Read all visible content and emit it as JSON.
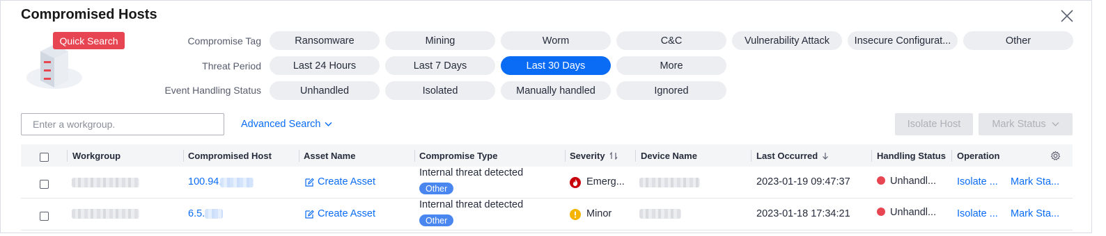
{
  "dialog": {
    "title": "Compromised Hosts",
    "quick_search": "Quick Search"
  },
  "filters": {
    "compromise_tag": {
      "label": "Compromise Tag",
      "options": [
        "Ransomware",
        "Mining",
        "Worm",
        "C&C",
        "Vulnerability Attack",
        "Insecure Configurat...",
        "Other"
      ]
    },
    "threat_period": {
      "label": "Threat Period",
      "options": [
        "Last 24 Hours",
        "Last 7 Days",
        "Last 30 Days",
        "More"
      ],
      "selected": "Last 30 Days"
    },
    "event_handling_status": {
      "label": "Event Handling Status",
      "options": [
        "Unhandled",
        "Isolated",
        "Manually handled",
        "Ignored"
      ]
    }
  },
  "toolbar": {
    "search_placeholder": "Enter a workgroup.",
    "advanced_search": "Advanced Search",
    "isolate_host": "Isolate Host",
    "mark_status": "Mark Status"
  },
  "table": {
    "columns": [
      "Workgroup",
      "Compromised Host",
      "Asset Name",
      "Compromise Type",
      "Severity",
      "Device Name",
      "Last Occurred",
      "Handling Status",
      "Operation"
    ],
    "rows": [
      {
        "compromised_host": "100.94.",
        "asset_name": "Create Asset",
        "compromise_type": "Internal threat detected",
        "type_tag": "Other",
        "severity": "Emerg...",
        "last_occurred": "2023-01-19 09:47:37",
        "handling_status": "Unhandl...",
        "op_isolate": "Isolate ...",
        "op_mark": "Mark Sta..."
      },
      {
        "compromised_host": "6.5.",
        "asset_name": "Create Asset",
        "compromise_type": "Internal threat detected",
        "type_tag": "Other",
        "severity": "Minor",
        "last_occurred": "2023-01-18 17:34:21",
        "handling_status": "Unhandl...",
        "op_isolate": "Isolate ...",
        "op_mark": "Mark Sta..."
      }
    ]
  },
  "colors": {
    "accent": "#0a6cf5",
    "danger": "#e84552",
    "warning": "#f5b400",
    "tag": "#4a86f0"
  },
  "icons": {
    "close": "close-icon",
    "settings": "gear-icon",
    "emergency": "flame-icon",
    "minor": "exclamation-icon",
    "edit": "edit-icon"
  }
}
